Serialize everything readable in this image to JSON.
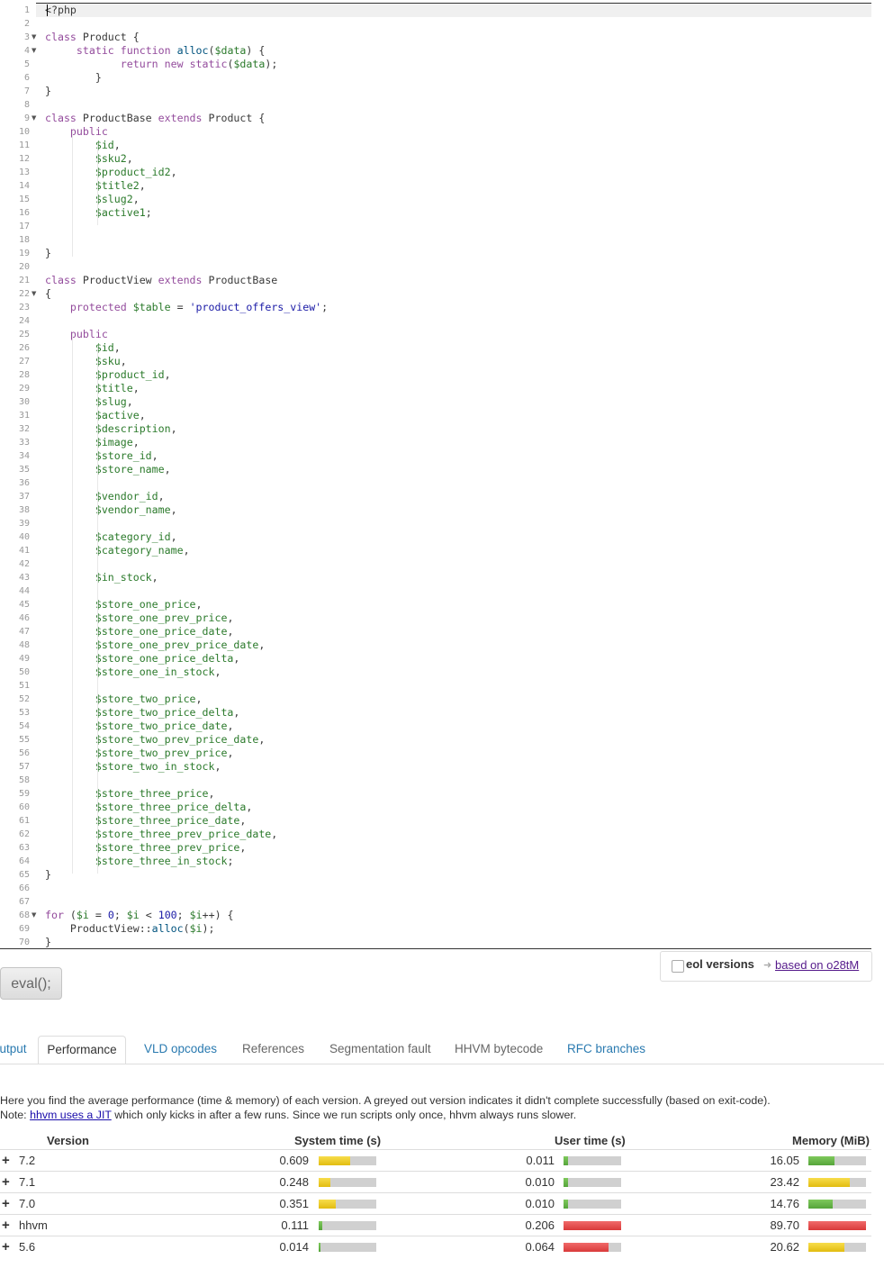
{
  "editor": {
    "lines": [
      {
        "n": "1",
        "t": "<?php"
      },
      {
        "n": "2",
        "t": ""
      },
      {
        "n": "3",
        "t": "class Product {",
        "fold": true
      },
      {
        "n": "4",
        "t": "     static function alloc($data) {",
        "fold": true
      },
      {
        "n": "5",
        "t": "            return new static($data);"
      },
      {
        "n": "6",
        "t": "        }"
      },
      {
        "n": "7",
        "t": "}"
      },
      {
        "n": "8",
        "t": ""
      },
      {
        "n": "9",
        "t": "class ProductBase extends Product {",
        "fold": true
      },
      {
        "n": "10",
        "t": "    public"
      },
      {
        "n": "11",
        "t": "        $id,"
      },
      {
        "n": "12",
        "t": "        $sku2,"
      },
      {
        "n": "13",
        "t": "        $product_id2,"
      },
      {
        "n": "14",
        "t": "        $title2,"
      },
      {
        "n": "15",
        "t": "        $slug2,"
      },
      {
        "n": "16",
        "t": "        $active1;"
      },
      {
        "n": "17",
        "t": ""
      },
      {
        "n": "18",
        "t": ""
      },
      {
        "n": "19",
        "t": "}"
      },
      {
        "n": "20",
        "t": ""
      },
      {
        "n": "21",
        "t": "class ProductView extends ProductBase"
      },
      {
        "n": "22",
        "t": "{",
        "fold": true
      },
      {
        "n": "23",
        "t": "    protected $table = 'product_offers_view';"
      },
      {
        "n": "24",
        "t": ""
      },
      {
        "n": "25",
        "t": "    public"
      },
      {
        "n": "26",
        "t": "        $id,"
      },
      {
        "n": "27",
        "t": "        $sku,"
      },
      {
        "n": "28",
        "t": "        $product_id,"
      },
      {
        "n": "29",
        "t": "        $title,"
      },
      {
        "n": "30",
        "t": "        $slug,"
      },
      {
        "n": "31",
        "t": "        $active,"
      },
      {
        "n": "32",
        "t": "        $description,"
      },
      {
        "n": "33",
        "t": "        $image,"
      },
      {
        "n": "34",
        "t": "        $store_id,"
      },
      {
        "n": "35",
        "t": "        $store_name,"
      },
      {
        "n": "36",
        "t": ""
      },
      {
        "n": "37",
        "t": "        $vendor_id,"
      },
      {
        "n": "38",
        "t": "        $vendor_name,"
      },
      {
        "n": "39",
        "t": ""
      },
      {
        "n": "40",
        "t": "        $category_id,"
      },
      {
        "n": "41",
        "t": "        $category_name,"
      },
      {
        "n": "42",
        "t": ""
      },
      {
        "n": "43",
        "t": "        $in_stock,"
      },
      {
        "n": "44",
        "t": ""
      },
      {
        "n": "45",
        "t": "        $store_one_price,"
      },
      {
        "n": "46",
        "t": "        $store_one_prev_price,"
      },
      {
        "n": "47",
        "t": "        $store_one_price_date,"
      },
      {
        "n": "48",
        "t": "        $store_one_prev_price_date,"
      },
      {
        "n": "49",
        "t": "        $store_one_price_delta,"
      },
      {
        "n": "50",
        "t": "        $store_one_in_stock,"
      },
      {
        "n": "51",
        "t": ""
      },
      {
        "n": "52",
        "t": "        $store_two_price,"
      },
      {
        "n": "53",
        "t": "        $store_two_price_delta,"
      },
      {
        "n": "54",
        "t": "        $store_two_price_date,"
      },
      {
        "n": "55",
        "t": "        $store_two_prev_price_date,"
      },
      {
        "n": "56",
        "t": "        $store_two_prev_price,"
      },
      {
        "n": "57",
        "t": "        $store_two_in_stock,"
      },
      {
        "n": "58",
        "t": ""
      },
      {
        "n": "59",
        "t": "        $store_three_price,"
      },
      {
        "n": "60",
        "t": "        $store_three_price_delta,"
      },
      {
        "n": "61",
        "t": "        $store_three_price_date,"
      },
      {
        "n": "62",
        "t": "        $store_three_prev_price_date,"
      },
      {
        "n": "63",
        "t": "        $store_three_prev_price,"
      },
      {
        "n": "64",
        "t": "        $store_three_in_stock;"
      },
      {
        "n": "65",
        "t": "}"
      },
      {
        "n": "66",
        "t": ""
      },
      {
        "n": "67",
        "t": ""
      },
      {
        "n": "68",
        "t": "for ($i = 0; $i < 100; $i++) {",
        "fold": true
      },
      {
        "n": "69",
        "t": "    ProductView::alloc($i);"
      },
      {
        "n": "70",
        "t": "}"
      }
    ]
  },
  "options": {
    "eol_label": "eol versions",
    "based_link": "based on o28tM"
  },
  "eval_button": "eval();",
  "tabs": [
    {
      "label": "Output",
      "style": "link"
    },
    {
      "label": "Performance",
      "style": "active"
    },
    {
      "label": "VLD opcodes",
      "style": "link"
    },
    {
      "label": "References",
      "style": "grey"
    },
    {
      "label": "Segmentation fault",
      "style": "grey"
    },
    {
      "label": "HHVM bytecode",
      "style": "grey"
    },
    {
      "label": "RFC branches",
      "style": "link"
    }
  ],
  "description": {
    "line1": "Here you find the average performance (time & memory) of each version. A greyed out version indicates it didn't complete successfully (based on exit-code).",
    "note_prefix": "Note: ",
    "note_link": "hhvm uses a JIT",
    "note_suffix": " which only kicks in after a few runs. Since we run scripts only once, hhvm always runs slower."
  },
  "table": {
    "headers": {
      "version": "Version",
      "system": "System time (s)",
      "user": "User time (s)",
      "memory": "Memory (MiB)"
    },
    "rows": [
      {
        "version": "7.2",
        "system": "0.609",
        "system_fill": 0.55,
        "system_color": "y",
        "user": "0.011",
        "user_fill": 0.08,
        "user_color": "g",
        "memory": "16.05",
        "memory_fill": 0.45,
        "memory_color": "g"
      },
      {
        "version": "7.1",
        "system": "0.248",
        "system_fill": 0.2,
        "system_color": "y",
        "user": "0.010",
        "user_fill": 0.08,
        "user_color": "g",
        "memory": "23.42",
        "memory_fill": 0.72,
        "memory_color": "y"
      },
      {
        "version": "7.0",
        "system": "0.351",
        "system_fill": 0.3,
        "system_color": "y",
        "user": "0.010",
        "user_fill": 0.08,
        "user_color": "g",
        "memory": "14.76",
        "memory_fill": 0.42,
        "memory_color": "g"
      },
      {
        "version": "hhvm",
        "system": "0.111",
        "system_fill": 0.06,
        "system_color": "g",
        "user": "0.206",
        "user_fill": 1.0,
        "user_color": "r",
        "memory": "89.70",
        "memory_fill": 1.0,
        "memory_color": "r"
      },
      {
        "version": "5.6",
        "system": "0.014",
        "system_fill": 0.02,
        "system_color": "g",
        "user": "0.064",
        "user_fill": 0.78,
        "user_color": "r",
        "memory": "20.62",
        "memory_fill": 0.62,
        "memory_color": "y"
      }
    ]
  }
}
